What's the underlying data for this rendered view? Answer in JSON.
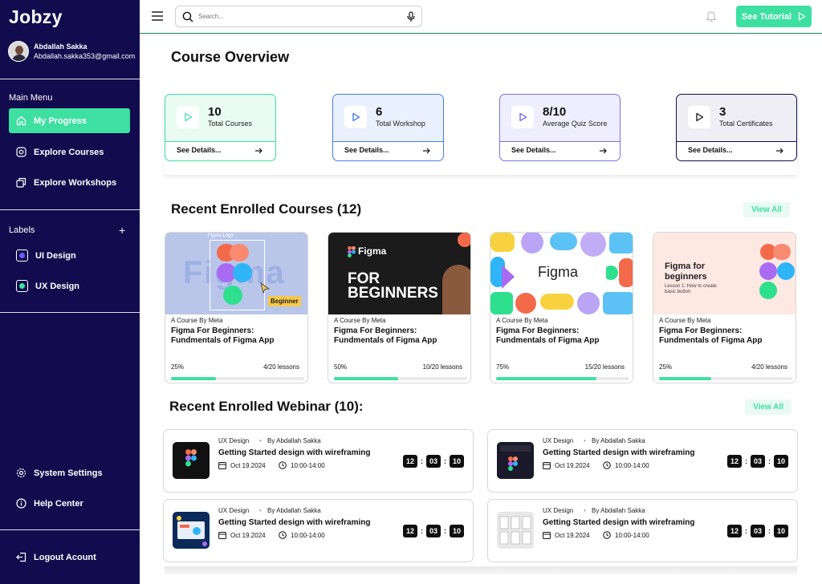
{
  "app": {
    "name": "Jobzy"
  },
  "user": {
    "name": "Abdallah Sakka",
    "email": "Abdallah.sakka353@gmail.com"
  },
  "sidebar": {
    "main_menu_title": "Main Menu",
    "menu": [
      {
        "label": "My Progress",
        "icon": "home-icon",
        "active": true
      },
      {
        "label": "Explore Courses",
        "icon": "compass-icon"
      },
      {
        "label": "Explore Workshops",
        "icon": "workshop-icon"
      }
    ],
    "labels_title": "Labels",
    "add_label_symbol": "+",
    "labels": [
      {
        "label": "UI Design",
        "color": "#6b5cff"
      },
      {
        "label": "UX Design",
        "color": "#3ee0a1"
      }
    ],
    "bottom": [
      {
        "label": "System Settings",
        "icon": "gear-icon"
      },
      {
        "label": "Help Center",
        "icon": "info-icon"
      }
    ],
    "logout": {
      "label": "Logout Acount",
      "icon": "logout-icon"
    }
  },
  "topbar": {
    "search_placeholder": "Search...",
    "tutorial_label": "See Tutorial"
  },
  "overview": {
    "title": "Course Overview",
    "stats": [
      {
        "value": "10",
        "label": "Total Courses",
        "see": "See Details...",
        "accent": "#3ee0a1",
        "bg": "#e9fbf3",
        "border": "#3ee0a1"
      },
      {
        "value": "6",
        "label": "Total Workshop",
        "see": "See Details...",
        "accent": "#3b6ff0",
        "bg": "#eaf1fe",
        "border": "#4a7bec"
      },
      {
        "value": "8/10",
        "label": "Average Quiz Score",
        "see": "See Details...",
        "accent": "#6b5cff",
        "bg": "#eeeefe",
        "border": "#7a72e8"
      },
      {
        "value": "3",
        "label": "Total Certificates",
        "see": "See Details...",
        "accent": "#111111",
        "bg": "#eeeef4",
        "border": "#120c4e"
      }
    ]
  },
  "courses": {
    "title": "Recent Enrolled Courses (12)",
    "view_all": "View All",
    "items": [
      {
        "meta": "A Course By Meta",
        "title": "Figma For Beginners: Fundmentals of Figma App",
        "percent": "25%",
        "progress": 0.34,
        "lessons": "4/20 lessons",
        "thumb_text": "Figma",
        "thumb_tag": "Beginner",
        "thumb_caption": "Figma Logo"
      },
      {
        "meta": "A Course By Meta",
        "title": "Figma For Beginners: Fundmentals of Figma App",
        "percent": "50%",
        "progress": 0.48,
        "lessons": "10/20 lessons",
        "thumb_text": "Figma",
        "thumb_big": "FOR BEGINNERS"
      },
      {
        "meta": "A Course By Meta",
        "title": "Figma For Beginners: Fundmentals of Figma App",
        "percent": "75%",
        "progress": 0.75,
        "lessons": "15/20 lessons",
        "thumb_text": "Figma"
      },
      {
        "meta": "A Course By Meta",
        "title": "Figma For Beginners: Fundmentals of Figma App",
        "percent": "25%",
        "progress": 0.39,
        "lessons": "4/20 lessons",
        "thumb_text": "Figma for beginners",
        "thumb_sub": "Lesson 1: How to create basic button"
      }
    ]
  },
  "webinars": {
    "title": "Recent Enrolled Webinar (10):",
    "view_all": "View All",
    "items": [
      {
        "category": "UX Design",
        "author": "By Abdallah Sakka",
        "title": "Getting Started design with wireframing",
        "date": "Oct 19.2024",
        "time": "10:00-14:00",
        "timer": [
          "12",
          "03",
          "10"
        ]
      },
      {
        "category": "UX Design",
        "author": "By Abdallah Sakka",
        "title": "Getting Started design with wireframing",
        "date": "Oct 19.2024",
        "time": "10:00-14:00",
        "timer": [
          "12",
          "03",
          "10"
        ]
      },
      {
        "category": "UX Design",
        "author": "By Abdallah Sakka",
        "title": "Getting Started design with wireframing",
        "date": "Oct 19.2024",
        "time": "10:00-14:00",
        "timer": [
          "12",
          "03",
          "10"
        ]
      },
      {
        "category": "UX Design",
        "author": "By Abdallah Sakka",
        "title": "Getting Started design with wireframing",
        "date": "Oct 19.2024",
        "time": "10:00-14:00",
        "timer": [
          "12",
          "03",
          "10"
        ]
      }
    ]
  }
}
